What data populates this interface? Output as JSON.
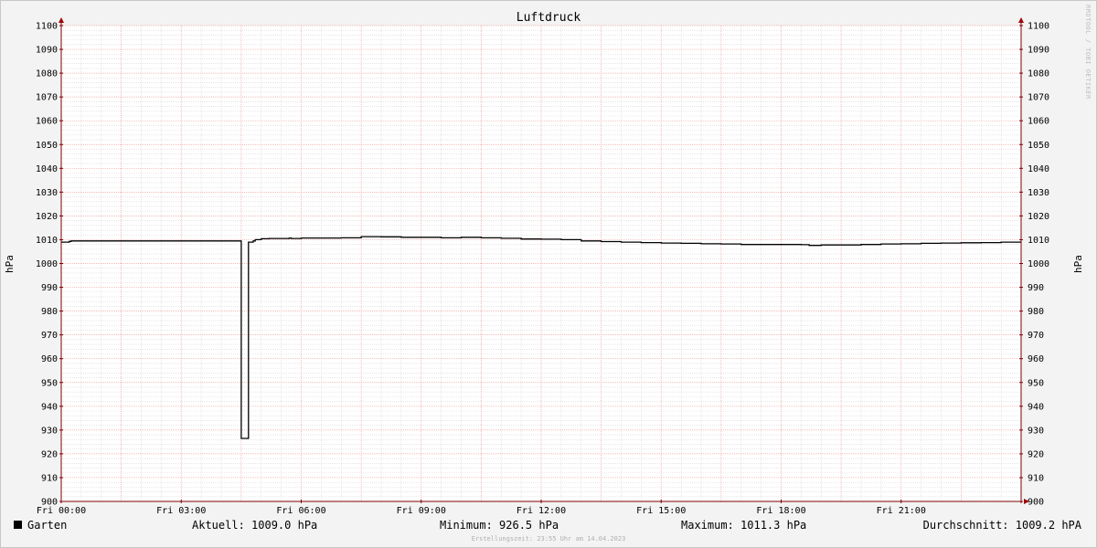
{
  "chart_data": {
    "type": "line",
    "title": "Luftdruck",
    "ylabel": "hPa",
    "xlabel": "",
    "ylim": [
      900,
      1100
    ],
    "ytick_step": 10,
    "y_minor_step": 2,
    "xlim_hours": [
      0,
      24
    ],
    "x_ticks": [
      {
        "hour": 0,
        "label": "Fri 00:00"
      },
      {
        "hour": 3,
        "label": "Fri 03:00"
      },
      {
        "hour": 6,
        "label": "Fri 06:00"
      },
      {
        "hour": 9,
        "label": "Fri 09:00"
      },
      {
        "hour": 12,
        "label": "Fri 12:00"
      },
      {
        "hour": 15,
        "label": "Fri 15:00"
      },
      {
        "hour": 18,
        "label": "Fri 18:00"
      },
      {
        "hour": 21,
        "label": "Fri 21:00"
      }
    ],
    "grid": true,
    "series": [
      {
        "name": "Garten",
        "color": "#000000",
        "x": [
          0,
          0.2,
          0.25,
          1,
          2,
          3,
          4,
          4.47,
          4.5,
          4.55,
          4.66,
          4.68,
          4.8,
          4.85,
          5.0,
          5.2,
          5.5,
          5.7,
          5.75,
          6,
          7,
          7.5,
          8,
          8.5,
          9,
          9.5,
          10,
          10.5,
          11,
          11.5,
          12,
          12.5,
          13,
          13.5,
          14,
          14.2,
          14.5,
          15,
          15.5,
          16,
          16.5,
          17,
          17.5,
          18,
          18.5,
          18.7,
          19,
          19.5,
          20,
          20.5,
          21,
          21.5,
          22,
          22.5,
          23,
          23.5,
          24
        ],
        "y": [
          1009.0,
          1009.3,
          1009.5,
          1009.5,
          1009.5,
          1009.5,
          1009.5,
          1009.5,
          926.5,
          926.5,
          926.5,
          1009.0,
          1009.5,
          1010.0,
          1010.4,
          1010.5,
          1010.5,
          1010.7,
          1010.5,
          1010.7,
          1010.8,
          1011.3,
          1011.2,
          1011.0,
          1011.0,
          1010.8,
          1011.0,
          1010.8,
          1010.6,
          1010.3,
          1010.2,
          1010.0,
          1009.5,
          1009.2,
          1009.0,
          1009.0,
          1008.8,
          1008.6,
          1008.5,
          1008.3,
          1008.2,
          1008.0,
          1008.0,
          1008.0,
          1007.9,
          1007.6,
          1007.8,
          1007.8,
          1008.0,
          1008.2,
          1008.3,
          1008.5,
          1008.6,
          1008.7,
          1008.8,
          1009.0,
          1009.0
        ]
      }
    ]
  },
  "watermark": "RRDTOOL / TOBI OETIKER",
  "legend": {
    "series_name": "Garten",
    "current": "Aktuell: 1009.0 hPa",
    "minimum": "Minimum: 926.5 hPa",
    "maximum": "Maximum: 1011.3 hPa",
    "average": "Durchschnitt: 1009.2 hPA"
  },
  "footer": "Erstellungszeit: 23:55 Uhr am 14.04.2023",
  "colors": {
    "background": "#f3f3f3",
    "plot_background": "#ffffff",
    "major_grid": "#f0a0a0",
    "minor_grid": "#d8d8d8",
    "axis": "#800000"
  }
}
